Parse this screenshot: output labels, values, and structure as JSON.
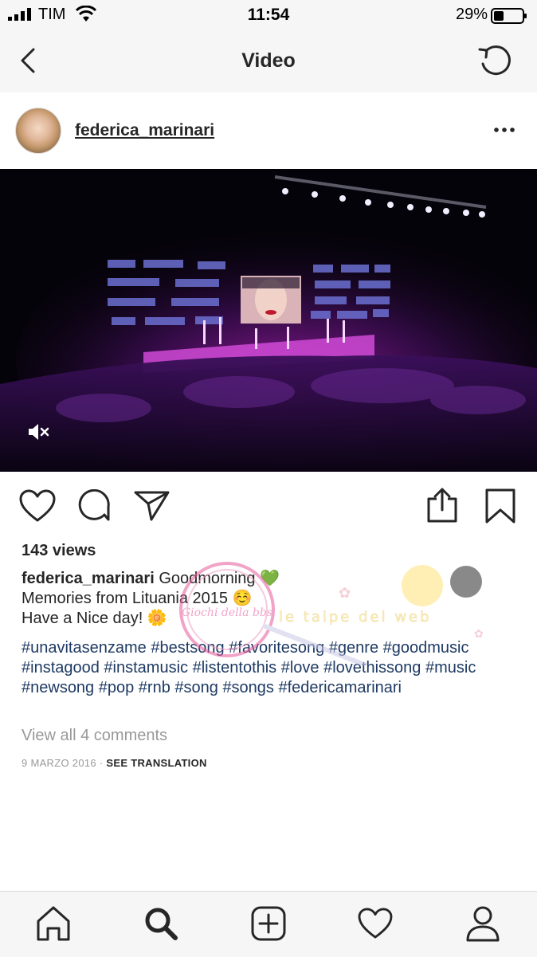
{
  "status_bar": {
    "carrier": "TIM",
    "time": "11:54",
    "battery": "29%"
  },
  "nav": {
    "title": "Video"
  },
  "post": {
    "username": "federica_marinari",
    "views": "143 views",
    "caption_user": "federica_marinari",
    "caption_line1": "Goodmorning",
    "caption_line1_emoji": "💚",
    "caption_line2": "Memories from Lituania 2015",
    "caption_line2_emoji": "☺️",
    "caption_line3": "Have a Nice day!",
    "caption_line3_emoji": "🌼",
    "hashtags": "#unavitasenzame #bestsong #favoritesong #genre #goodmusic #instagood #instamusic #listentothis #love #lovethissong #music #newsong #pop #rnb #song #songs #federicamarinari",
    "view_comments": "View all 4 comments",
    "date": "9 MARZO 2016",
    "date_sep": " · ",
    "see_translation": "SEE TRANSLATION"
  },
  "watermark": {
    "text": "le taipe del web",
    "seal": "Giochi della bbs"
  },
  "colors": {
    "hashtag": "#1e3a63",
    "muted": "#999999",
    "bar_bg": "#f6f6f6"
  },
  "icons": [
    "back-icon",
    "refresh-icon",
    "more-icon",
    "mute-icon",
    "heart-icon",
    "comment-icon",
    "share-icon",
    "upload-icon",
    "bookmark-icon",
    "home-icon",
    "search-icon",
    "add-icon",
    "activity-icon",
    "profile-icon"
  ]
}
